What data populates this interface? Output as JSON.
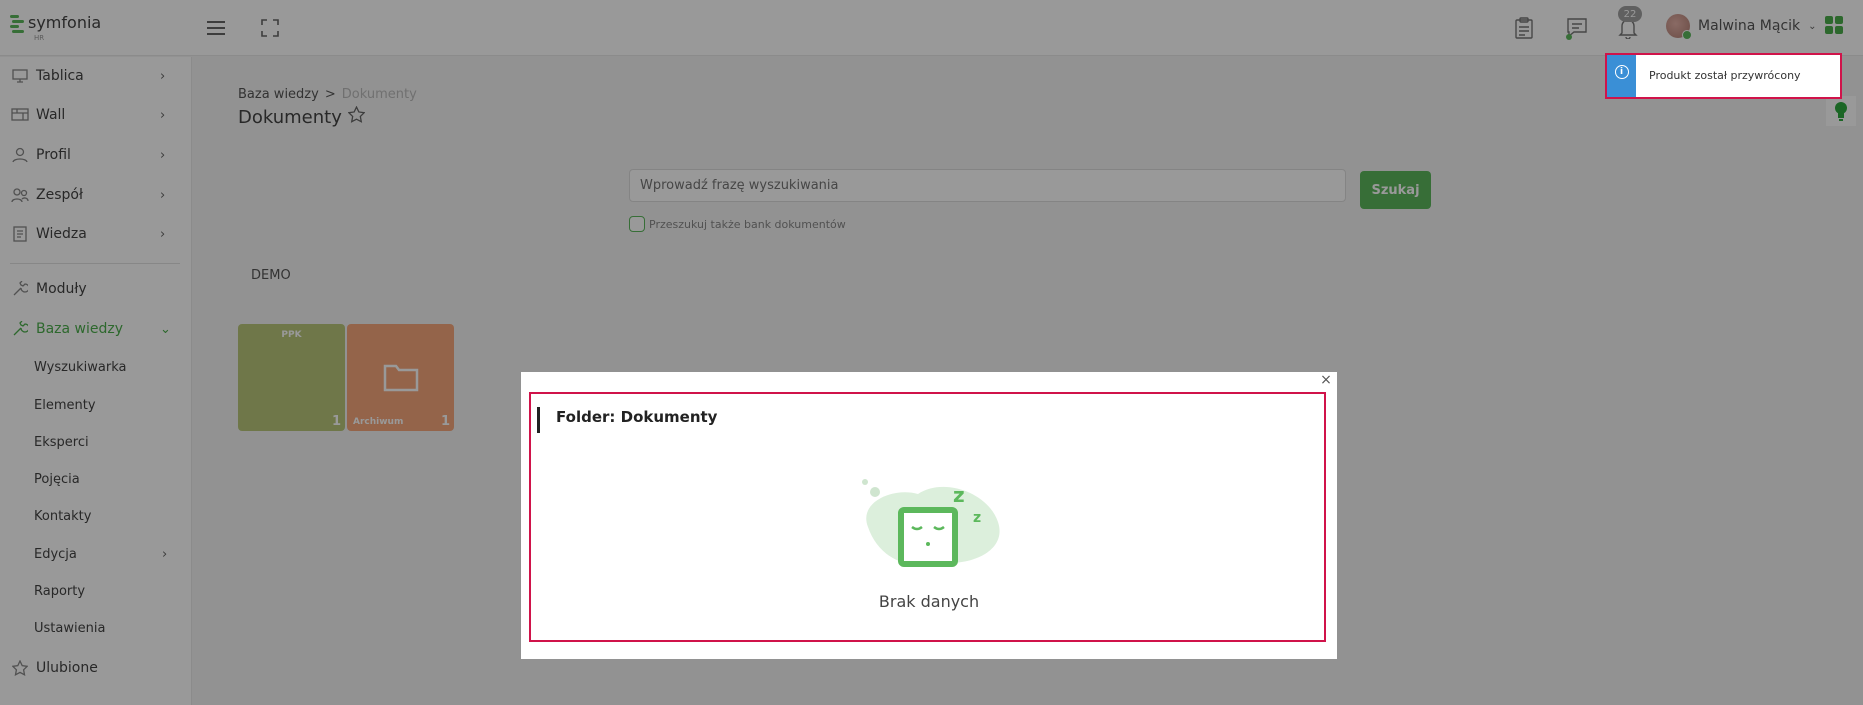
{
  "app": {
    "brand": "symfonia",
    "brand_sub": "HR"
  },
  "header": {
    "notifications_count": "22",
    "user_name": "Malwina Mącik"
  },
  "sidebar": {
    "items": [
      {
        "label": "Tablica",
        "icon": "monitor-icon"
      },
      {
        "label": "Wall",
        "icon": "wall-icon"
      },
      {
        "label": "Profil",
        "icon": "user-icon"
      },
      {
        "label": "Zespół",
        "icon": "team-icon"
      },
      {
        "label": "Wiedza",
        "icon": "book-icon"
      },
      {
        "label": "Moduły",
        "icon": "wrench-icon"
      },
      {
        "label": "Baza wiedzy",
        "icon": "wrench-icon"
      }
    ],
    "sub_items": [
      "Wyszukiwarka",
      "Elementy",
      "Eksperci",
      "Pojęcia",
      "Kontakty",
      "Edycja",
      "Raporty",
      "Ustawienia"
    ],
    "favorites": "Ulubione"
  },
  "breadcrumb": {
    "root": "Baza wiedzy",
    "separator": ">",
    "current": "Dokumenty"
  },
  "page": {
    "title": "Dokumenty"
  },
  "search": {
    "placeholder": "Wprowadź frazę wyszukiwania",
    "button": "Szukaj",
    "checkbox_label": "Przeszukuj także bank dokumentów"
  },
  "section": {
    "label": "DEMO"
  },
  "tiles": [
    {
      "name": "PPK",
      "count": "1",
      "color": "#b9c77a"
    },
    {
      "name": "Archiwum",
      "count": "1",
      "color": "#f7a77c"
    }
  ],
  "modal": {
    "close": "×",
    "title": "Folder: Dokumenty",
    "empty_text": "Brak danych"
  },
  "toast": {
    "text": "Produkt został przywrócony"
  },
  "colors": {
    "accent": "#5cb85c",
    "highlight": "#d0134a",
    "info": "#3a8fd6"
  }
}
